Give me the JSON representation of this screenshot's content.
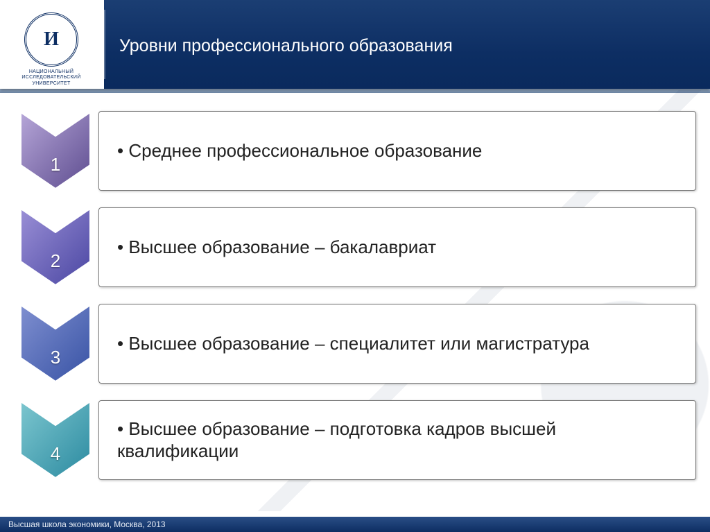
{
  "header": {
    "logo_caption_line1": "НАЦИОНАЛЬНЫЙ ИССЛЕДОВАТЕЛЬСКИЙ",
    "logo_caption_line2": "УНИВЕРСИТЕТ",
    "title": "Уровни профессионального образования"
  },
  "colors": {
    "row1_a": "#b6a6d8",
    "row1_b": "#5d4c8f",
    "row2_a": "#9a8fd6",
    "row2_b": "#4a46a2",
    "row3_a": "#7f8fd0",
    "row3_b": "#3752a4",
    "row4_a": "#7cc6cf",
    "row4_b": "#2b8aa0"
  },
  "rows": [
    {
      "num": "1",
      "text": "• Среднее профессиональное образование"
    },
    {
      "num": "2",
      "text": "• Высшее образование – бакалавриат"
    },
    {
      "num": "3",
      "text": "• Высшее образование – специалитет или магистратура"
    },
    {
      "num": "4",
      "text": "• Высшее образование – подготовка кадров высшей квалификации"
    }
  ],
  "footer": "Высшая школа экономики, Москва, 2013"
}
